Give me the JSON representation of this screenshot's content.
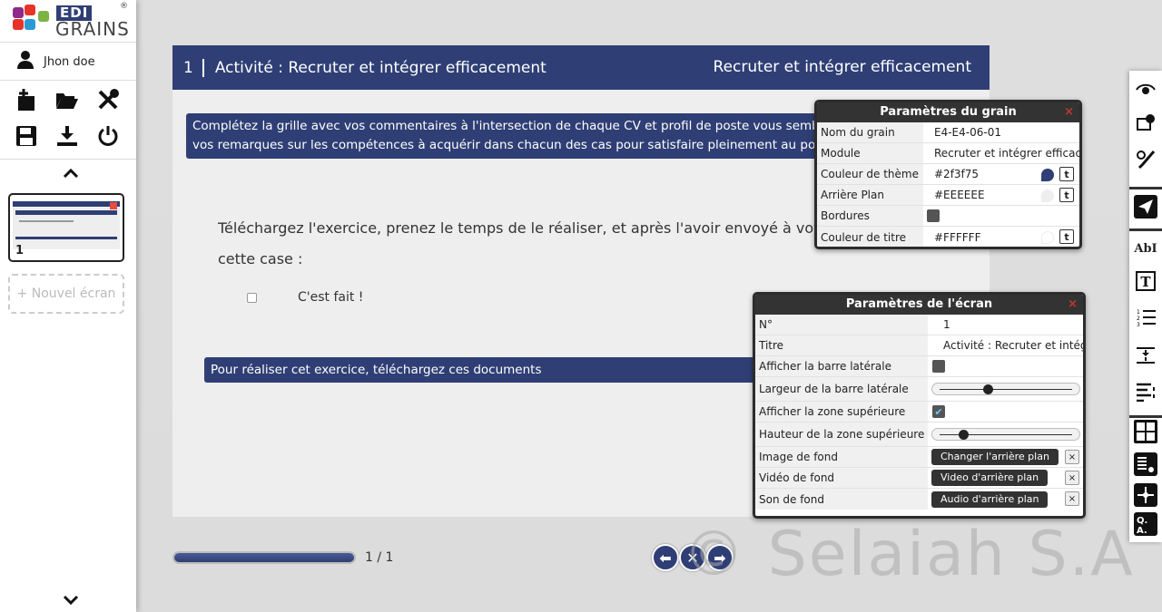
{
  "brand": {
    "edi": "EDI",
    "grains": "GRAINS",
    "reg": "®"
  },
  "user": {
    "name": "Jhon doe"
  },
  "thumbnail": {
    "number": "1"
  },
  "sidebar": {
    "new_screen": "+ Nouvel écran"
  },
  "header": {
    "number": "1",
    "title": "Activité : Recruter et intégrer efficacement",
    "right_title": "Recruter et intégrer efficacement"
  },
  "content": {
    "instruction_line1": "Complétez la grille avec vos commentaires à l'intersection de chaque CV et profil de poste vous semblan",
    "instruction_line2": "vos remarques sur les compétences à acquérir dans chacun des cas pour satisfaire pleinement au poste, s",
    "body_line1": "Téléchargez l'exercice, prenez le temps de le réaliser, et après l'avoir envoyé à votre tute",
    "body_line2": "cette case  :",
    "done_label": "C'est fait !",
    "documents_bar": "Pour réaliser cet exercice, téléchargez ces documents"
  },
  "footer": {
    "page_count": "1 / 1",
    "progress": 1.0
  },
  "watermark": "© Selaiah S.A",
  "grain_params": {
    "title": "Paramètres du grain",
    "close": "×",
    "rows": [
      {
        "label": "Nom du grain",
        "value": "E4-E4-06-01"
      },
      {
        "label": "Module",
        "value": "Recruter et intégrer efficac"
      },
      {
        "label": "Couleur de thème",
        "value": "#2f3f75",
        "t": "t"
      },
      {
        "label": "Arrière Plan",
        "value": "#EEEEEE",
        "t": "t"
      },
      {
        "label": "Bordures",
        "value": ""
      },
      {
        "label": "Couleur de titre",
        "value": "#FFFFFF",
        "t": "t"
      }
    ]
  },
  "screen_params": {
    "title": "Paramètres de l'écran",
    "close": "×",
    "number_label": "N°",
    "number_value": "1",
    "title_label": "Titre",
    "title_value": "Activité : Recruter et intég",
    "sidebar_label": "Afficher la barre latérale",
    "sidebar_width_label": "Largeur de la barre latérale",
    "sidebar_width": 0.35,
    "top_zone_label": "Afficher la zone supérieure",
    "top_zone_height_label": "Hauteur de la zone supérieure",
    "top_zone_height": 0.15,
    "bg_image_label": "Image de fond",
    "bg_image_button": "Changer l'arrière plan",
    "bg_video_label": "Vidéo de fond",
    "bg_video_button": "Video d'arrière plan",
    "bg_sound_label": "Son de fond",
    "bg_sound_button": "Audio d'arrière plan",
    "x": "×"
  },
  "colors": {
    "theme": "#2f3f75",
    "background": "#EEEEEE",
    "title": "#FFFFFF"
  },
  "icons": {
    "left_toolbar": [
      "add-icon",
      "folder-icon",
      "tools-icon",
      "save-icon",
      "download-icon",
      "power-icon"
    ],
    "right_toolbar": [
      "eye-icon",
      "settings-icon",
      "paint-icon",
      "send-icon",
      "text-style-icon",
      "text-icon",
      "numbered-list-icon",
      "spacing-icon",
      "align-icon",
      "grid-icon",
      "media-icon",
      "diagram-icon",
      "qa-icon"
    ]
  }
}
